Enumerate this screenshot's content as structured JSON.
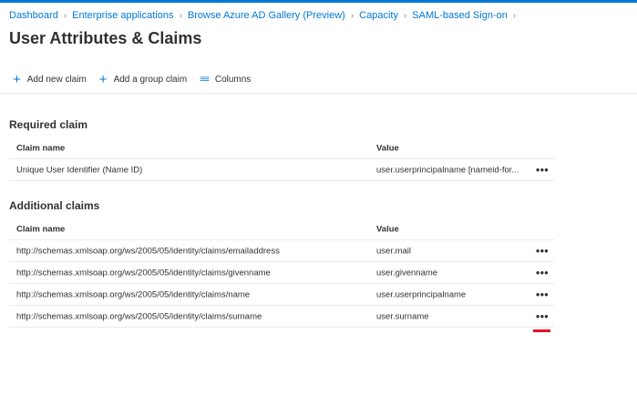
{
  "breadcrumb": [
    {
      "label": "Dashboard"
    },
    {
      "label": "Enterprise applications"
    },
    {
      "label": "Browse Azure AD Gallery (Preview)"
    },
    {
      "label": "Capacity"
    },
    {
      "label": "SAML-based Sign-on"
    }
  ],
  "page": {
    "title": "User Attributes & Claims"
  },
  "toolbar": {
    "add_claim": "Add new claim",
    "add_group_claim": "Add a group claim",
    "columns": "Columns"
  },
  "required": {
    "title": "Required claim",
    "col_name": "Claim name",
    "col_value": "Value",
    "rows": [
      {
        "name": "Unique User Identifier (Name ID)",
        "value": "user.userprincipalname [nameid-for...",
        "more": "•••"
      }
    ]
  },
  "additional": {
    "title": "Additional claims",
    "col_name": "Claim name",
    "col_value": "Value",
    "rows": [
      {
        "name": "http://schemas.xmlsoap.org/ws/2005/05/identity/claims/emailaddress",
        "value": "user.mail",
        "more": "•••"
      },
      {
        "name": "http://schemas.xmlsoap.org/ws/2005/05/identity/claims/givenname",
        "value": "user.givenname",
        "more": "•••"
      },
      {
        "name": "http://schemas.xmlsoap.org/ws/2005/05/identity/claims/name",
        "value": "user.userprincipalname",
        "more": "•••"
      },
      {
        "name": "http://schemas.xmlsoap.org/ws/2005/05/identity/claims/surname",
        "value": "user.surname",
        "more": "•••"
      }
    ]
  },
  "colors": {
    "accent": "#0078d4",
    "highlight": "#e81123"
  }
}
